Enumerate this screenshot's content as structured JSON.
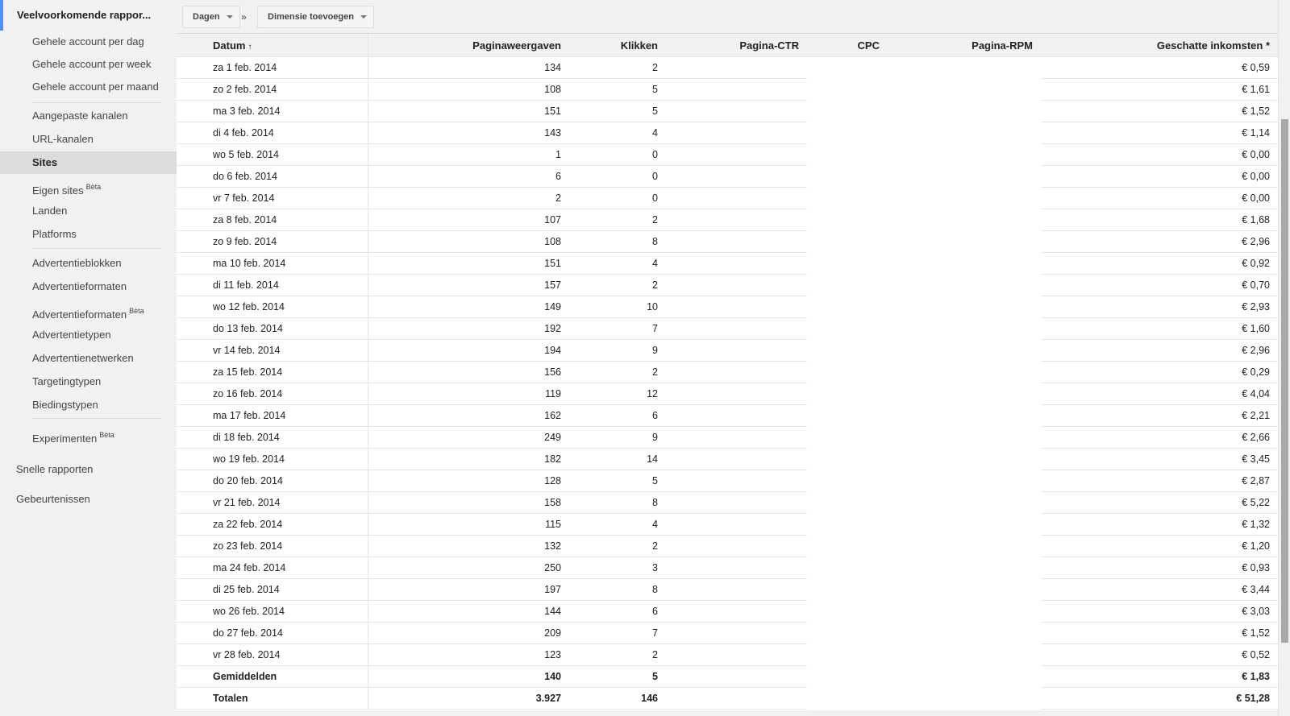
{
  "sidebar": {
    "title": "Veelvoorkomende rappor...",
    "items": [
      {
        "label": "Gehele account per dag"
      },
      {
        "label": "Gehele account per week"
      },
      {
        "label": "Gehele account per maand"
      },
      {
        "label": "Aangepaste kanalen"
      },
      {
        "label": "URL-kanalen"
      },
      {
        "label": "Sites"
      },
      {
        "label": "Eigen sites",
        "badge": "Bèta"
      },
      {
        "label": "Landen"
      },
      {
        "label": "Platforms"
      },
      {
        "label": "Advertentieblokken"
      },
      {
        "label": "Advertentieformaten"
      },
      {
        "label": "Advertentieformaten",
        "badge": "Bèta"
      },
      {
        "label": "Advertentietypen"
      },
      {
        "label": "Advertentienetwerken"
      },
      {
        "label": "Targetingtypen"
      },
      {
        "label": "Biedingstypen"
      },
      {
        "label": "Experimenten",
        "badge": "Bèta"
      }
    ],
    "sections": [
      {
        "label": "Snelle rapporten"
      },
      {
        "label": "Gebeurtenissen"
      }
    ]
  },
  "toolbar": {
    "days_label": "Dagen",
    "separator": "»",
    "add_dimension_label": "Dimensie toevoegen"
  },
  "table": {
    "headers": {
      "date": "Datum",
      "sort_arrow": "↑",
      "pageviews": "Paginaweergaven",
      "clicks": "Klikken",
      "ctr": "Pagina-CTR",
      "cpc": "CPC",
      "rpm": "Pagina-RPM",
      "earnings": "Geschatte inkomsten *"
    },
    "rows": [
      {
        "date": "za 1 feb. 2014",
        "pageviews": "134",
        "clicks": "2",
        "earnings": "€ 0,59"
      },
      {
        "date": "zo 2 feb. 2014",
        "pageviews": "108",
        "clicks": "5",
        "earnings": "€ 1,61"
      },
      {
        "date": "ma 3 feb. 2014",
        "pageviews": "151",
        "clicks": "5",
        "earnings": "€ 1,52"
      },
      {
        "date": "di 4 feb. 2014",
        "pageviews": "143",
        "clicks": "4",
        "earnings": "€ 1,14"
      },
      {
        "date": "wo 5 feb. 2014",
        "pageviews": "1",
        "clicks": "0",
        "earnings": "€ 0,00"
      },
      {
        "date": "do 6 feb. 2014",
        "pageviews": "6",
        "clicks": "0",
        "earnings": "€ 0,00"
      },
      {
        "date": "vr 7 feb. 2014",
        "pageviews": "2",
        "clicks": "0",
        "earnings": "€ 0,00"
      },
      {
        "date": "za 8 feb. 2014",
        "pageviews": "107",
        "clicks": "2",
        "earnings": "€ 1,68"
      },
      {
        "date": "zo 9 feb. 2014",
        "pageviews": "108",
        "clicks": "8",
        "earnings": "€ 2,96"
      },
      {
        "date": "ma 10 feb. 2014",
        "pageviews": "151",
        "clicks": "4",
        "earnings": "€ 0,92"
      },
      {
        "date": "di 11 feb. 2014",
        "pageviews": "157",
        "clicks": "2",
        "earnings": "€ 0,70"
      },
      {
        "date": "wo 12 feb. 2014",
        "pageviews": "149",
        "clicks": "10",
        "earnings": "€ 2,93"
      },
      {
        "date": "do 13 feb. 2014",
        "pageviews": "192",
        "clicks": "7",
        "earnings": "€ 1,60"
      },
      {
        "date": "vr 14 feb. 2014",
        "pageviews": "194",
        "clicks": "9",
        "earnings": "€ 2,96"
      },
      {
        "date": "za 15 feb. 2014",
        "pageviews": "156",
        "clicks": "2",
        "earnings": "€ 0,29"
      },
      {
        "date": "zo 16 feb. 2014",
        "pageviews": "119",
        "clicks": "12",
        "earnings": "€ 4,04"
      },
      {
        "date": "ma 17 feb. 2014",
        "pageviews": "162",
        "clicks": "6",
        "earnings": "€ 2,21"
      },
      {
        "date": "di 18 feb. 2014",
        "pageviews": "249",
        "clicks": "9",
        "earnings": "€ 2,66"
      },
      {
        "date": "wo 19 feb. 2014",
        "pageviews": "182",
        "clicks": "14",
        "earnings": "€ 3,45"
      },
      {
        "date": "do 20 feb. 2014",
        "pageviews": "128",
        "clicks": "5",
        "earnings": "€ 2,87"
      },
      {
        "date": "vr 21 feb. 2014",
        "pageviews": "158",
        "clicks": "8",
        "earnings": "€ 5,22"
      },
      {
        "date": "za 22 feb. 2014",
        "pageviews": "115",
        "clicks": "4",
        "earnings": "€ 1,32"
      },
      {
        "date": "zo 23 feb. 2014",
        "pageviews": "132",
        "clicks": "2",
        "earnings": "€ 1,20"
      },
      {
        "date": "ma 24 feb. 2014",
        "pageviews": "250",
        "clicks": "3",
        "earnings": "€ 0,93"
      },
      {
        "date": "di 25 feb. 2014",
        "pageviews": "197",
        "clicks": "8",
        "earnings": "€ 3,44"
      },
      {
        "date": "wo 26 feb. 2014",
        "pageviews": "144",
        "clicks": "6",
        "earnings": "€ 3,03"
      },
      {
        "date": "do 27 feb. 2014",
        "pageviews": "209",
        "clicks": "7",
        "earnings": "€ 1,52"
      },
      {
        "date": "vr 28 feb. 2014",
        "pageviews": "123",
        "clicks": "2",
        "earnings": "€ 0,52"
      }
    ],
    "averages": {
      "date": "Gemiddelden",
      "pageviews": "140",
      "clicks": "5",
      "earnings": "€ 1,83"
    },
    "totals": {
      "date": "Totalen",
      "pageviews": "3.927",
      "clicks": "146",
      "earnings": "€ 51,28"
    }
  },
  "colors": {
    "accent": "#4d90fe",
    "active_item_bg": "#dcdcdc",
    "header_bg": "#f1f1f1"
  }
}
